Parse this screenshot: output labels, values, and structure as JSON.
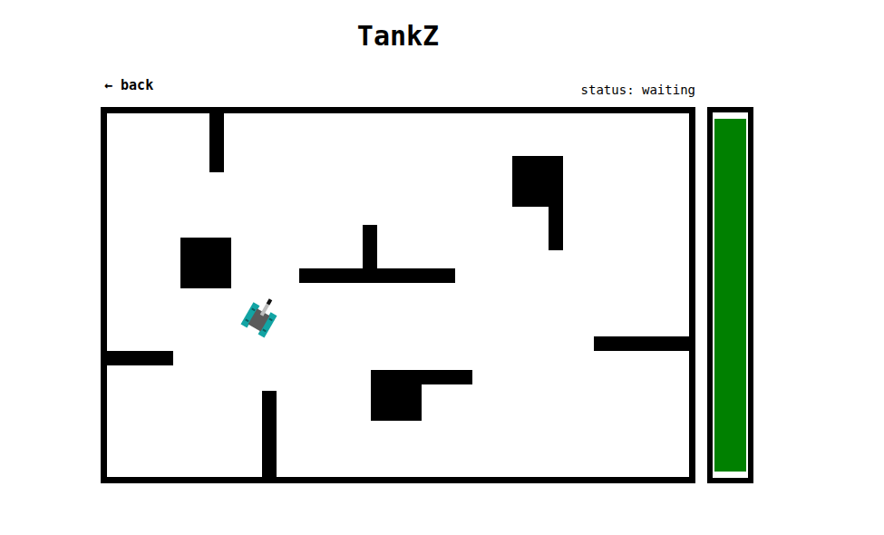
{
  "title": "TankZ",
  "back_link": "← back",
  "status": "status: waiting",
  "health_bar": {
    "level": 1
  }
}
